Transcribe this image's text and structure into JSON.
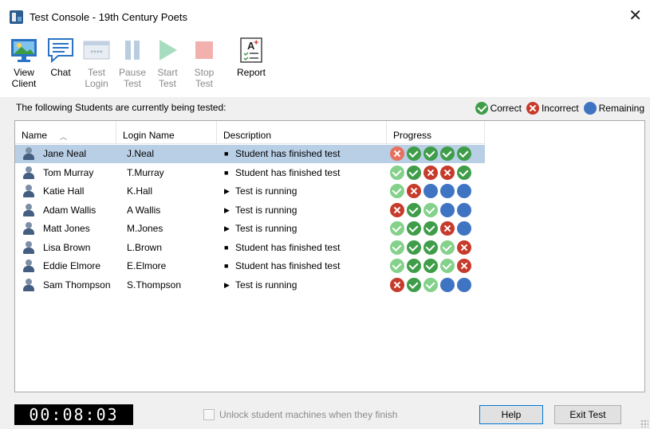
{
  "window": {
    "title": "Test Console - 19th Century Poets"
  },
  "toolbar": {
    "view_client": "View\nClient",
    "chat": "Chat",
    "test_login": "Test\nLogin",
    "pause_test": "Pause\nTest",
    "start_test": "Start\nTest",
    "stop_test": "Stop\nTest",
    "report": "Report"
  },
  "caption": "The following Students are currently being tested:",
  "legend": {
    "correct": "Correct",
    "incorrect": "Incorrect",
    "remaining": "Remaining"
  },
  "columns": {
    "name": "Name",
    "login": "Login Name",
    "description": "Description",
    "progress": "Progress"
  },
  "students": [
    {
      "name": "Jane Neal",
      "login": "J.Neal",
      "marker": "■",
      "description": "Student has finished test",
      "progress": [
        "incorrect-light",
        "correct",
        "correct",
        "correct",
        "correct"
      ]
    },
    {
      "name": "Tom Murray",
      "login": "T.Murray",
      "marker": "■",
      "description": "Student has finished test",
      "progress": [
        "correct-light",
        "correct",
        "incorrect",
        "incorrect",
        "correct"
      ]
    },
    {
      "name": "Katie Hall",
      "login": "K.Hall",
      "marker": "▶",
      "description": "Test is running",
      "progress": [
        "correct-light",
        "incorrect",
        "remaining",
        "remaining",
        "remaining"
      ]
    },
    {
      "name": "Adam Wallis",
      "login": "A Wallis",
      "marker": "▶",
      "description": "Test is running",
      "progress": [
        "incorrect",
        "correct",
        "correct-light",
        "remaining",
        "remaining"
      ]
    },
    {
      "name": "Matt Jones",
      "login": "M.Jones",
      "marker": "▶",
      "description": "Test is running",
      "progress": [
        "correct-light",
        "correct",
        "correct",
        "incorrect",
        "remaining"
      ]
    },
    {
      "name": "Lisa Brown",
      "login": "L.Brown",
      "marker": "■",
      "description": "Student has finished test",
      "progress": [
        "correct-light",
        "correct",
        "correct",
        "correct-light",
        "incorrect"
      ]
    },
    {
      "name": "Eddie Elmore",
      "login": "E.Elmore",
      "marker": "■",
      "description": "Student has finished test",
      "progress": [
        "correct-light",
        "correct",
        "correct",
        "correct-light",
        "incorrect"
      ]
    },
    {
      "name": "Sam Thompson",
      "login": "S.Thompson",
      "marker": "▶",
      "description": "Test is running",
      "progress": [
        "incorrect",
        "correct",
        "correct-light",
        "remaining",
        "remaining"
      ]
    }
  ],
  "timer": "00:08:03",
  "unlock_label": "Unlock student machines when they finish",
  "buttons": {
    "help": "Help",
    "exit": "Exit Test"
  },
  "colors": {
    "correct": "#3f9d49",
    "incorrect": "#c63b2b",
    "remaining": "#3f74c3",
    "selection": "#b9cfe6"
  }
}
